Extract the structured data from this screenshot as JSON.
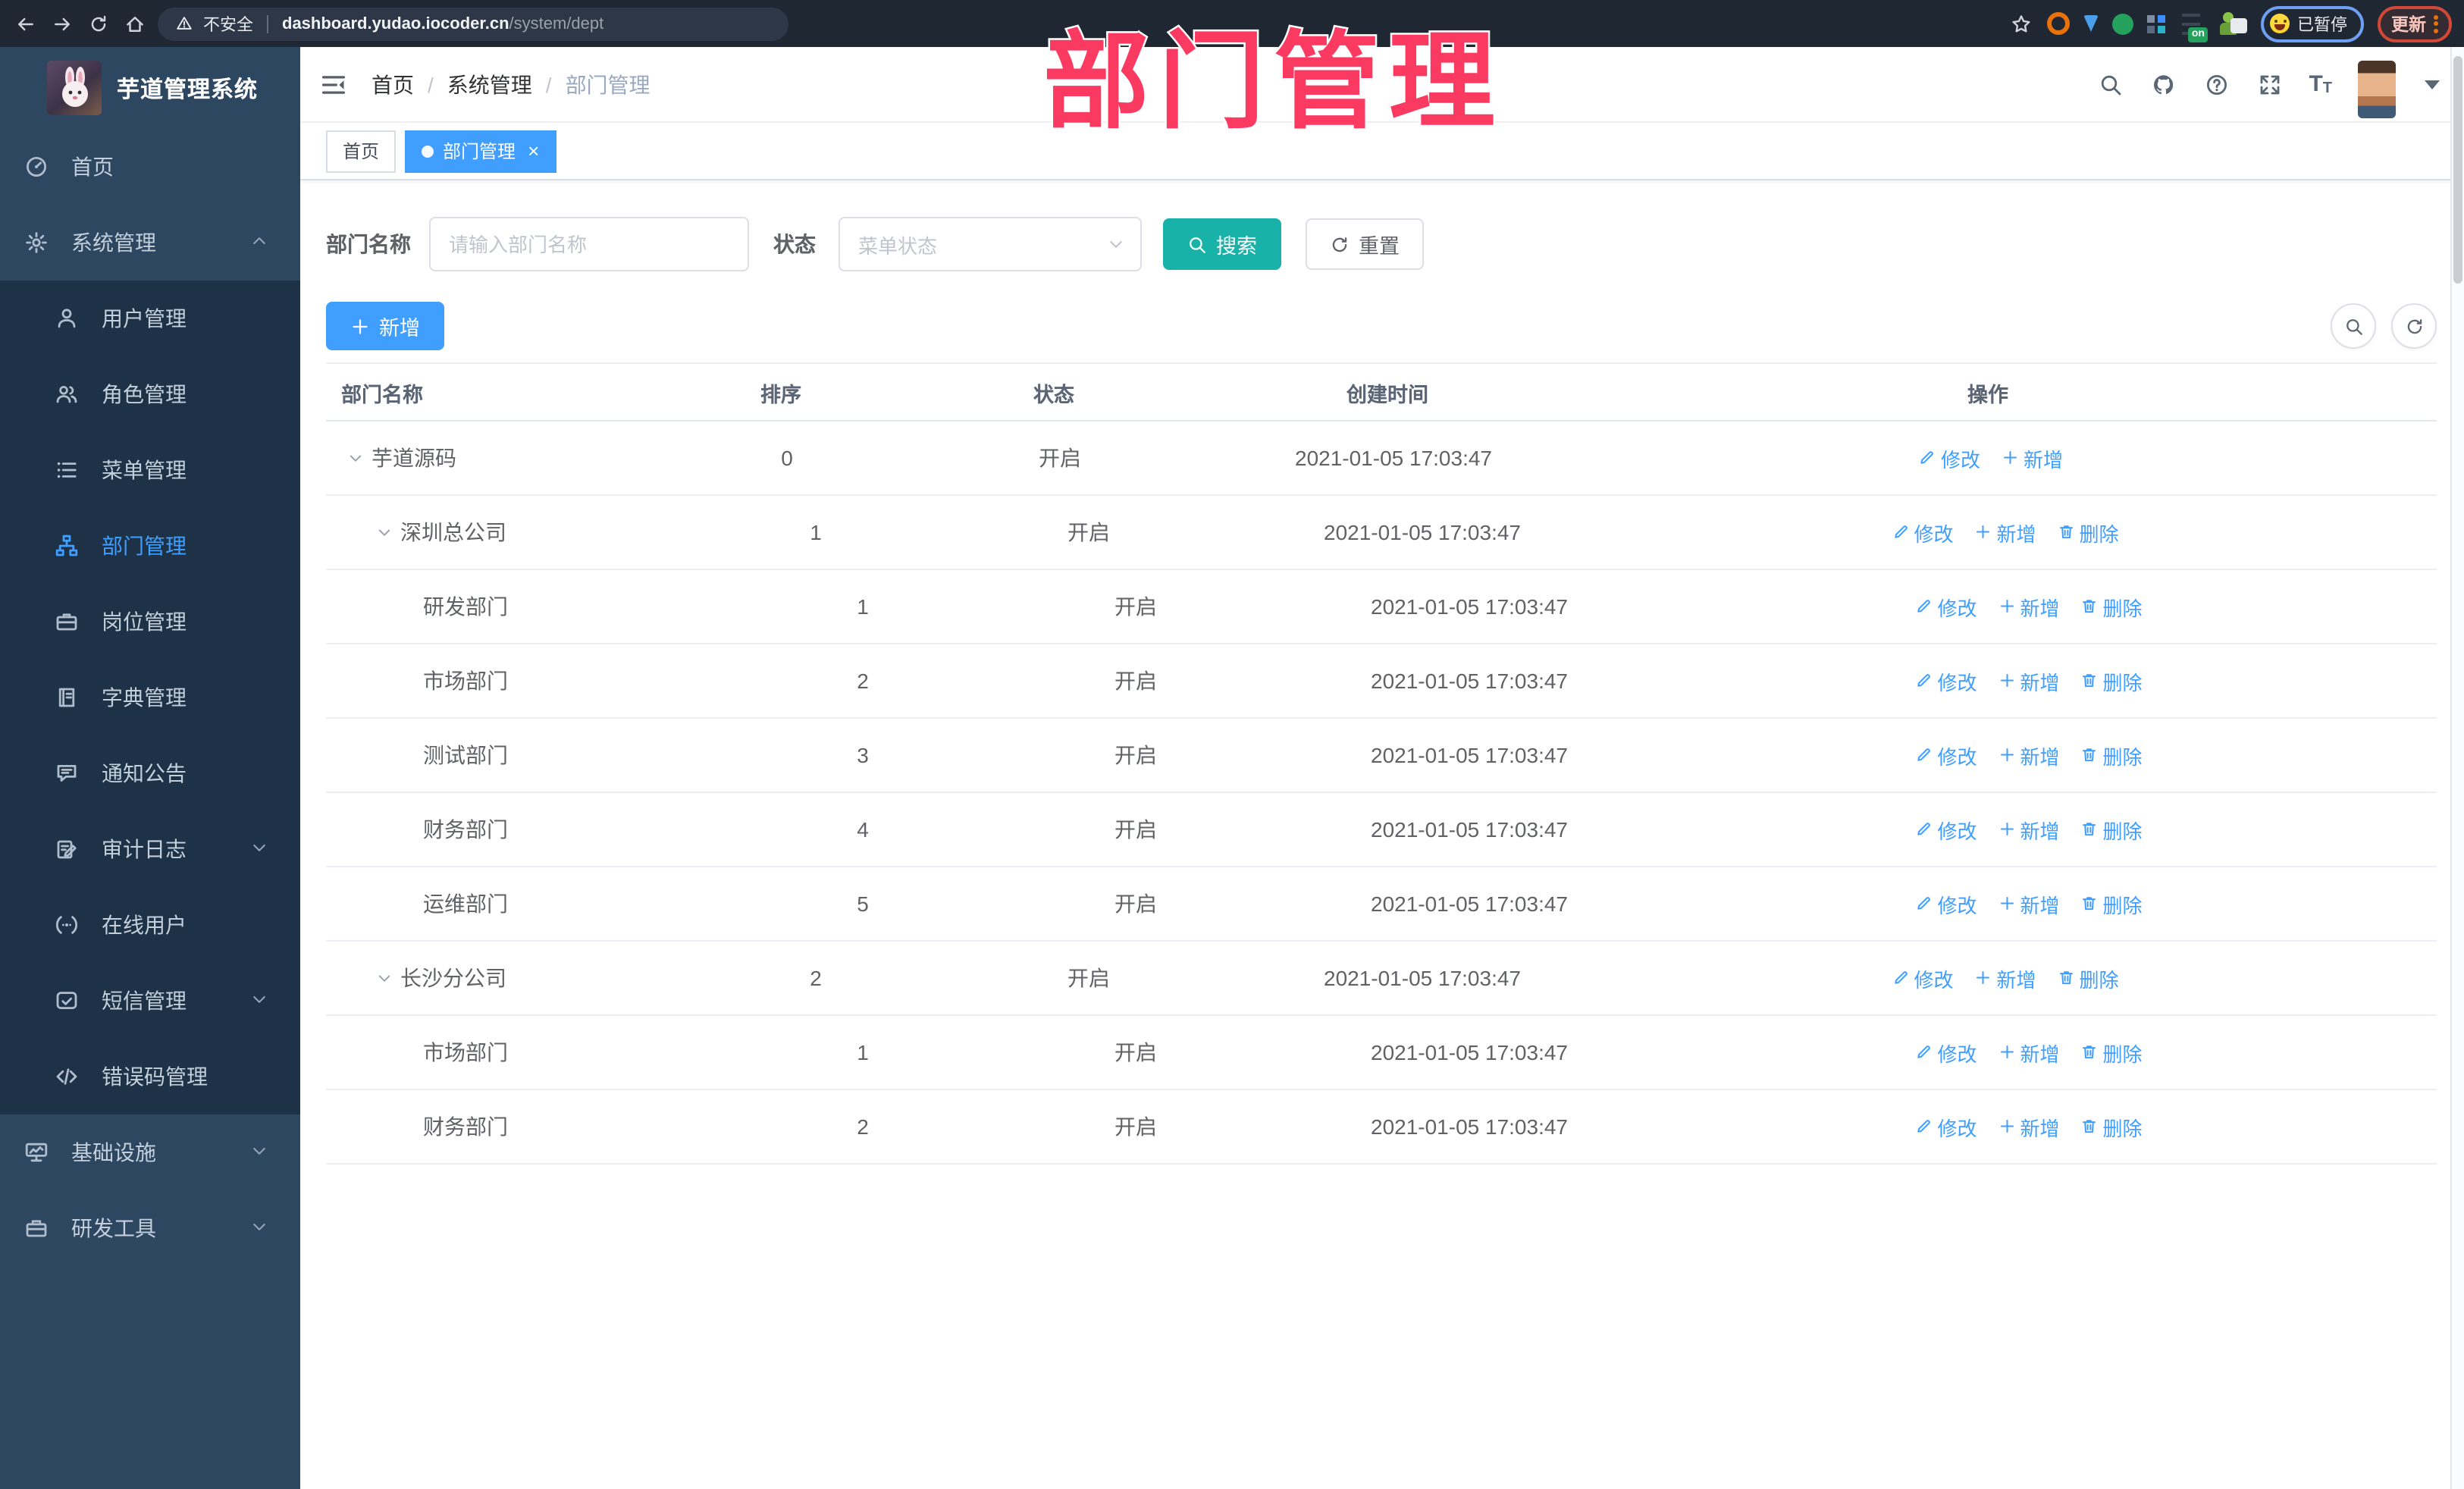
{
  "browser": {
    "security_label": "不安全",
    "url_host": "dashboard.yudao.iocoder.cn",
    "url_path": "/system/dept",
    "paused_label": "已暂停",
    "update_label": "更新",
    "onetab_badge": "on",
    "extension_icons": [
      "target-extension-icon",
      "pin-extension-icon",
      "check-extension-icon",
      "grid-extension-icon",
      "onetab-extension-icon",
      "figure-extension-icon",
      "puzzle-extension-icon"
    ]
  },
  "watermark": "部门管理",
  "sidebar": {
    "title": "芋道管理系统",
    "items": [
      {
        "id": "home",
        "label": "首页",
        "icon": "dashboard-icon",
        "type": "top"
      },
      {
        "id": "system",
        "label": "系统管理",
        "icon": "gear-icon",
        "type": "top",
        "arrow": "up"
      },
      {
        "id": "user",
        "label": "用户管理",
        "icon": "user-icon",
        "type": "sub"
      },
      {
        "id": "role",
        "label": "角色管理",
        "icon": "users-icon",
        "type": "sub"
      },
      {
        "id": "menu",
        "label": "菜单管理",
        "icon": "menu-list-icon",
        "type": "sub"
      },
      {
        "id": "dept",
        "label": "部门管理",
        "icon": "org-tree-icon",
        "type": "sub",
        "active": true
      },
      {
        "id": "post",
        "label": "岗位管理",
        "icon": "briefcase-icon",
        "type": "sub"
      },
      {
        "id": "dict",
        "label": "字典管理",
        "icon": "dictionary-icon",
        "type": "sub"
      },
      {
        "id": "notice",
        "label": "通知公告",
        "icon": "announcement-icon",
        "type": "sub"
      },
      {
        "id": "audit-log",
        "label": "审计日志",
        "icon": "audit-log-icon",
        "type": "sub",
        "arrow": "down"
      },
      {
        "id": "online-user",
        "label": "在线用户",
        "icon": "online-user-icon",
        "type": "sub"
      },
      {
        "id": "sms",
        "label": "短信管理",
        "icon": "sms-icon",
        "type": "sub",
        "arrow": "down"
      },
      {
        "id": "error-code",
        "label": "错误码管理",
        "icon": "error-code-icon",
        "type": "sub"
      },
      {
        "id": "infra",
        "label": "基础设施",
        "icon": "infrastructure-icon",
        "type": "top",
        "arrow": "down"
      },
      {
        "id": "dev-tools",
        "label": "研发工具",
        "icon": "dev-tools-icon",
        "type": "top",
        "arrow": "down"
      }
    ]
  },
  "header": {
    "breadcrumb": [
      "首页",
      "系统管理",
      "部门管理"
    ],
    "breadcrumb_separator": "/"
  },
  "tabs": [
    {
      "label": "首页",
      "active": false,
      "closable": false
    },
    {
      "label": "部门管理",
      "active": true,
      "closable": true
    }
  ],
  "filters": {
    "name_label": "部门名称",
    "name_placeholder": "请输入部门名称",
    "status_label": "状态",
    "status_placeholder": "菜单状态",
    "search_label": "搜索",
    "reset_label": "重置"
  },
  "toolbar": {
    "add_label": "新增"
  },
  "table": {
    "columns": [
      "部门名称",
      "排序",
      "状态",
      "创建时间",
      "操作"
    ],
    "action_labels": {
      "edit": "修改",
      "add": "新增",
      "delete": "删除"
    },
    "rows": [
      {
        "name": "芋道源码",
        "level": 0,
        "expandable": true,
        "sort": "0",
        "status": "开启",
        "created": "2021-01-05 17:03:47",
        "actions": [
          "edit",
          "add"
        ]
      },
      {
        "name": "深圳总公司",
        "level": 1,
        "expandable": true,
        "sort": "1",
        "status": "开启",
        "created": "2021-01-05 17:03:47",
        "actions": [
          "edit",
          "add",
          "delete"
        ]
      },
      {
        "name": "研发部门",
        "level": 2,
        "expandable": false,
        "sort": "1",
        "status": "开启",
        "created": "2021-01-05 17:03:47",
        "actions": [
          "edit",
          "add",
          "delete"
        ]
      },
      {
        "name": "市场部门",
        "level": 2,
        "expandable": false,
        "sort": "2",
        "status": "开启",
        "created": "2021-01-05 17:03:47",
        "actions": [
          "edit",
          "add",
          "delete"
        ]
      },
      {
        "name": "测试部门",
        "level": 2,
        "expandable": false,
        "sort": "3",
        "status": "开启",
        "created": "2021-01-05 17:03:47",
        "actions": [
          "edit",
          "add",
          "delete"
        ]
      },
      {
        "name": "财务部门",
        "level": 2,
        "expandable": false,
        "sort": "4",
        "status": "开启",
        "created": "2021-01-05 17:03:47",
        "actions": [
          "edit",
          "add",
          "delete"
        ]
      },
      {
        "name": "运维部门",
        "level": 2,
        "expandable": false,
        "sort": "5",
        "status": "开启",
        "created": "2021-01-05 17:03:47",
        "actions": [
          "edit",
          "add",
          "delete"
        ]
      },
      {
        "name": "长沙分公司",
        "level": 1,
        "expandable": true,
        "sort": "2",
        "status": "开启",
        "created": "2021-01-05 17:03:47",
        "actions": [
          "edit",
          "add",
          "delete"
        ]
      },
      {
        "name": "市场部门",
        "level": 2,
        "expandable": false,
        "sort": "1",
        "status": "开启",
        "created": "2021-01-05 17:03:47",
        "actions": [
          "edit",
          "add",
          "delete"
        ]
      },
      {
        "name": "财务部门",
        "level": 2,
        "expandable": false,
        "sort": "2",
        "status": "开启",
        "created": "2021-01-05 17:03:47",
        "actions": [
          "edit",
          "add",
          "delete"
        ]
      }
    ]
  }
}
